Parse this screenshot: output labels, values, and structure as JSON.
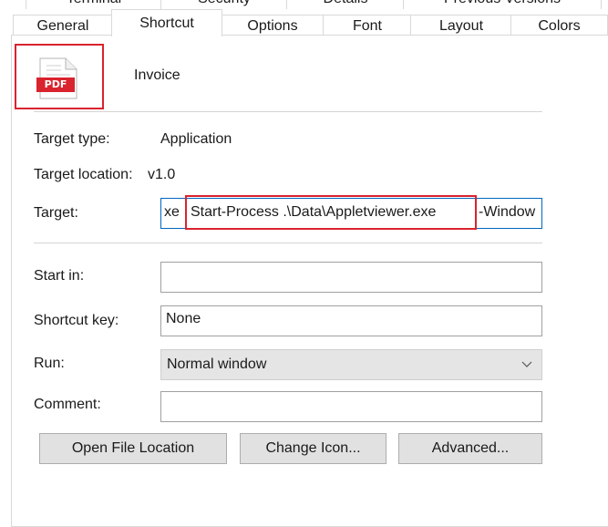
{
  "tabs_back": [
    "Terminal",
    "Security",
    "Details",
    "Previous Versions"
  ],
  "tabs_front": [
    "General",
    "Shortcut",
    "Options",
    "Font",
    "Layout",
    "Colors"
  ],
  "active_tab": "Shortcut",
  "shortcut": {
    "icon_badge": "PDF",
    "name": "Invoice"
  },
  "fields": {
    "target_type_label": "Target type:",
    "target_type_value": "Application",
    "target_location_label": "Target location:",
    "target_location_value": "v1.0",
    "target_label": "Target:",
    "target_prefix": "xe",
    "target_highlight": "Start-Process .\\Data\\Appletviewer.exe",
    "target_suffix": "-Window",
    "start_in_label": "Start in:",
    "start_in_value": "",
    "shortcut_key_label": "Shortcut key:",
    "shortcut_key_value": "None",
    "run_label": "Run:",
    "run_value": "Normal window",
    "comment_label": "Comment:",
    "comment_value": ""
  },
  "buttons": {
    "open_file_location": "Open File Location",
    "change_icon": "Change Icon...",
    "advanced": "Advanced..."
  },
  "colors": {
    "highlight_border": "#d9232e",
    "pdf_red": "#d9232e",
    "focus_blue": "#0067c0"
  },
  "icons": {
    "file_icon": "pdf-file-icon",
    "dropdown": "chevron-down-icon"
  }
}
